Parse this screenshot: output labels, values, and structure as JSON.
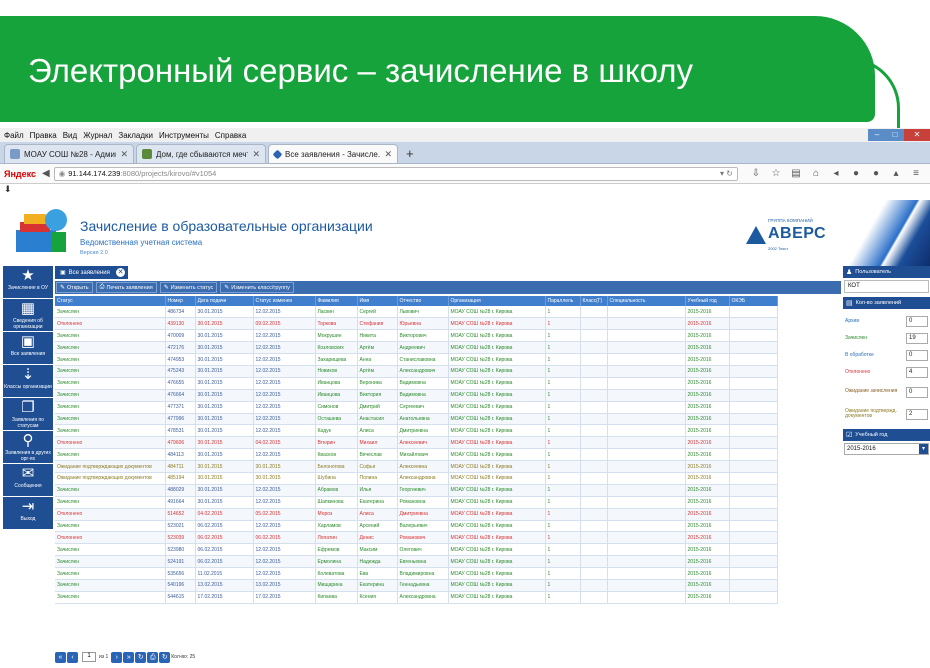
{
  "slide": {
    "title": "Электронный сервис – зачисление в школу"
  },
  "browser": {
    "menu": [
      "Файл",
      "Правка",
      "Вид",
      "Журнал",
      "Закладки",
      "Инструменты",
      "Справка"
    ],
    "tabs": [
      {
        "label": "МОАУ СОШ №28 - Админ...",
        "active": false
      },
      {
        "label": "Дом, где сбываются мечт...",
        "active": false
      },
      {
        "label": "Все заявления - Зачисле...",
        "active": true
      }
    ],
    "brand": "Яндекс",
    "url_host": "91.144.174.239",
    "url_path": ":8080/projects/kirovo/#v1054"
  },
  "app": {
    "title": "Зачисление в образовательные организации",
    "subtitle": "Ведомственная учетная система",
    "version": "Версия 2.0",
    "vendor_small": "ГРУППА КОМПАНИЙ",
    "vendor_name": "АВЕРС",
    "vendor_tag": "2002 Текст"
  },
  "leftnav": [
    {
      "icon": "star-icon",
      "glyph": "★",
      "label": "Зачисление в ОУ"
    },
    {
      "icon": "building-icon",
      "glyph": "▦",
      "label": "Сведения об организации"
    },
    {
      "icon": "briefcase-icon",
      "glyph": "▣",
      "label": "Все заявления"
    },
    {
      "icon": "sort-icon",
      "glyph": "⇣",
      "label": "Классы организации"
    },
    {
      "icon": "stack-icon",
      "glyph": "❐",
      "label": "Заявления по статусам"
    },
    {
      "icon": "search-icon",
      "glyph": "⚲",
      "label": "Заявления в других орг-ях"
    },
    {
      "icon": "mail-icon",
      "glyph": "✉",
      "label": "Сообщения"
    },
    {
      "icon": "logout-icon",
      "glyph": "⇥",
      "label": "Выход"
    }
  ],
  "center": {
    "tab_label": "Все заявления",
    "toolbar": [
      {
        "icon": "edit-icon",
        "glyph": "✎",
        "label": "Открыть"
      },
      {
        "icon": "print-icon",
        "glyph": "⎙",
        "label": "Печать заявления"
      },
      {
        "icon": "edit-icon",
        "glyph": "✎",
        "label": "Изменить статус"
      },
      {
        "icon": "edit-icon",
        "glyph": "✎",
        "label": "Изменить класс/группу"
      }
    ],
    "columns": [
      "Статус",
      "Номер",
      "Дата подачи",
      "Статус изменен",
      "Фамилия",
      "Имя",
      "Отчество",
      "Организация",
      "Параллель",
      "Класс(Г)",
      "Специальность",
      "Учебный год",
      "ОКЭБ"
    ],
    "rows": [
      [
        "Зачислен",
        "486734",
        "30.01.2015",
        "12.02.2015",
        "Ласкин",
        "Сергей",
        "Львович",
        "МОАУ СОШ №28 г. Кирова",
        "1",
        "",
        "",
        "2015-2016",
        ""
      ],
      [
        "Отклонено",
        "439130",
        "30.01.2015",
        "09.02.2015",
        "Торкова",
        "Стефания",
        "Юрьевна",
        "МОАУ СОШ №28 г. Кирова",
        "1",
        "",
        "",
        "2015-2016",
        ""
      ],
      [
        "Зачислен",
        "470009",
        "30.01.2015",
        "12.02.2015",
        "Мокрушин",
        "Никита",
        "Викторович",
        "МОАУ СОШ №28 г. Кирова",
        "1",
        "",
        "",
        "2015-2016",
        ""
      ],
      [
        "Зачислен",
        "472176",
        "30.01.2015",
        "12.02.2015",
        "Козловских",
        "Артём",
        "Андреевич",
        "МОАУ СОШ №28 г. Кирова",
        "1",
        "",
        "",
        "2015-2016",
        ""
      ],
      [
        "Зачислен",
        "474953",
        "30.01.2015",
        "12.02.2015",
        "Захарищева",
        "Анна",
        "Станиславовна",
        "МОАУ СОШ №28 г. Кирова",
        "1",
        "",
        "",
        "2015-2016",
        ""
      ],
      [
        "Зачислен",
        "475243",
        "30.01.2015",
        "12.02.2015",
        "Новиков",
        "Артём",
        "Александрович",
        "МОАУ СОШ №28 г. Кирова",
        "1",
        "",
        "",
        "2015-2016",
        ""
      ],
      [
        "Зачислен",
        "476655",
        "30.01.2015",
        "12.02.2015",
        "Иванцова",
        "Вероника",
        "Вадимовна",
        "МОАУ СОШ №28 г. Кирова",
        "1",
        "",
        "",
        "2015-2016",
        ""
      ],
      [
        "Зачислен",
        "476664",
        "30.01.2015",
        "12.02.2015",
        "Иванцова",
        "Виктория",
        "Вадимовна",
        "МОАУ СОШ №28 г. Кирова",
        "1",
        "",
        "",
        "2015-2016",
        ""
      ],
      [
        "Зачислен",
        "477371",
        "30.01.2015",
        "12.02.2015",
        "Симонов",
        "Дмитрий",
        "Сергеевич",
        "МОАУ СОШ №28 г. Кирова",
        "1",
        "",
        "",
        "2015-2016",
        ""
      ],
      [
        "Зачислен",
        "477996",
        "30.01.2015",
        "12.02.2015",
        "Осташева",
        "Анастасия",
        "Анатольевна",
        "МОАУ СОШ №28 г. Кирова",
        "1",
        "",
        "",
        "2015-2016",
        ""
      ],
      [
        "Зачислен",
        "478531",
        "30.01.2015",
        "12.02.2015",
        "Кадук",
        "Алиса",
        "Дмитриевна",
        "МОАУ СОШ №28 г. Кирова",
        "1",
        "",
        "",
        "2015-2016",
        ""
      ],
      [
        "Отклонено",
        "479606",
        "30.01.2015",
        "04.02.2015",
        "Втюрин",
        "Михаил",
        "Алексеевич",
        "МОАУ СОШ №28 г. Кирова",
        "1",
        "",
        "",
        "2015-2016",
        ""
      ],
      [
        "Зачислен",
        "484113",
        "30.01.2015",
        "12.02.2015",
        "Квасков",
        "Вячеслав",
        "Михайлович",
        "МОАУ СОШ №28 г. Кирова",
        "1",
        "",
        "",
        "2015-2016",
        ""
      ],
      [
        "Ожидание подтверждающих документов",
        "484711",
        "30.01.2015",
        "30.01.2015",
        "Белоногова",
        "Софья",
        "Алексеевна",
        "МОАУ СОШ №28 г. Кирова",
        "1",
        "",
        "",
        "2015-2016",
        ""
      ],
      [
        "Ожидание подтверждающих документов",
        "485194",
        "30.01.2015",
        "30.01.2015",
        "Шубина",
        "Полина",
        "Александровна",
        "МОАУ СОШ №28 г. Кирова",
        "1",
        "",
        "",
        "2015-2016",
        ""
      ],
      [
        "Зачислен",
        "488029",
        "30.01.2015",
        "12.02.2015",
        "Абрамов",
        "Илья",
        "Георгиевич",
        "МОАУ СОШ №28 г. Кирова",
        "1",
        "",
        "",
        "2015-2016",
        ""
      ],
      [
        "Зачислен",
        "491664",
        "30.01.2015",
        "12.02.2015",
        "Шапкинова",
        "Екатерина",
        "Романовна",
        "МОАУ СОШ №28 г. Кирова",
        "1",
        "",
        "",
        "2015-2016",
        ""
      ],
      [
        "Отклонено",
        "514652",
        "04.02.2015",
        "05.02.2015",
        "Мороз",
        "Алиса",
        "Дмитриевна",
        "МОАУ СОШ №28 г. Кирова",
        "1",
        "",
        "",
        "2015-2016",
        ""
      ],
      [
        "Зачислен",
        "523021",
        "06.02.2015",
        "12.02.2015",
        "Харламов",
        "Арсений",
        "Валерьевич",
        "МОАУ СОШ №28 г. Кирова",
        "1",
        "",
        "",
        "2015-2016",
        ""
      ],
      [
        "Отклонено",
        "523039",
        "06.02.2015",
        "06.02.2015",
        "Лопатин",
        "Денис",
        "Романович",
        "МОАУ СОШ №28 г. Кирова",
        "1",
        "",
        "",
        "2015-2016",
        ""
      ],
      [
        "Зачислен",
        "523980",
        "06.02.2015",
        "12.02.2015",
        "Ефремов",
        "Максим",
        "Олегович",
        "МОАУ СОШ №28 г. Кирова",
        "1",
        "",
        "",
        "2015-2016",
        ""
      ],
      [
        "Зачислен",
        "524191",
        "06.02.2015",
        "12.02.2015",
        "Ермолина",
        "Надежда",
        "Евгеньевна",
        "МОАУ СОШ №28 г. Кирова",
        "1",
        "",
        "",
        "2015-2016",
        ""
      ],
      [
        "Зачислен",
        "535656",
        "11.02.2015",
        "12.02.2015",
        "Колеватова",
        "Ева",
        "Владимировна",
        "МОАУ СОШ №28 г. Кирова",
        "1",
        "",
        "",
        "2015-2016",
        ""
      ],
      [
        "Зачислен",
        "540196",
        "13.02.2015",
        "13.02.2015",
        "Мищарина",
        "Екатерина",
        "Геннадьевна",
        "МОАУ СОШ №28 г. Кирова",
        "1",
        "",
        "",
        "2015-2016",
        ""
      ],
      [
        "Зачислен",
        "544615",
        "17.02.2015",
        "17.02.2015",
        "Кипаева",
        "Ксения",
        "Александровна",
        "МОАУ СОШ №28 г. Кирова",
        "1",
        "",
        "",
        "2015-2016",
        ""
      ]
    ],
    "pager": {
      "page": "1",
      "of_label": "из 1",
      "count_label": "Кол-во: 25"
    }
  },
  "rpanel": {
    "user_header": "Пользователь",
    "user_value": "КОТ",
    "count_header": "Кол-во заявлений",
    "counts": [
      {
        "label": "Архив",
        "value": "0"
      },
      {
        "label": "Зачислен",
        "value": "19"
      },
      {
        "label": "В обработке",
        "value": "0"
      },
      {
        "label": "Отклонено",
        "value": "4"
      },
      {
        "label": "Ожидание зачисления",
        "value": "0"
      },
      {
        "label": "Ожидание подтвержд. документов",
        "value": "2"
      }
    ],
    "year_header": "Учебный год",
    "year_value": "2015-2016"
  },
  "colors": {
    "banner": "#17a33b",
    "nav_blue": "#1f4e93",
    "header_blue": "#3f7fce",
    "accepted": "#2a8a2a",
    "rejected": "#d83232",
    "waiting": "#8a7a20"
  }
}
